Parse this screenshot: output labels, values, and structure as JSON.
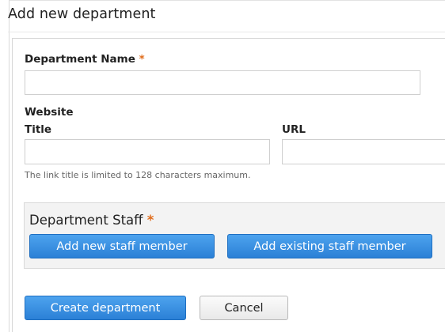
{
  "page": {
    "title": "Add new department"
  },
  "form": {
    "department_name": {
      "label": "Department Name",
      "required_marker": "*",
      "value": "",
      "placeholder": ""
    },
    "website": {
      "heading": "Website",
      "title": {
        "label": "Title",
        "value": "",
        "placeholder": ""
      },
      "url": {
        "label": "URL",
        "value": "",
        "placeholder": ""
      },
      "help_text": "The link title is limited to 128 characters maximum."
    },
    "staff": {
      "heading": "Department Staff",
      "required_marker": "*",
      "add_new_label": "Add new staff member",
      "add_existing_label": "Add existing staff member"
    },
    "actions": {
      "create_label": "Create department",
      "cancel_label": "Cancel"
    }
  },
  "colors": {
    "required": "#e06c1b",
    "primary_button": "#2b80d6",
    "panel_background": "#f3f3f3"
  }
}
